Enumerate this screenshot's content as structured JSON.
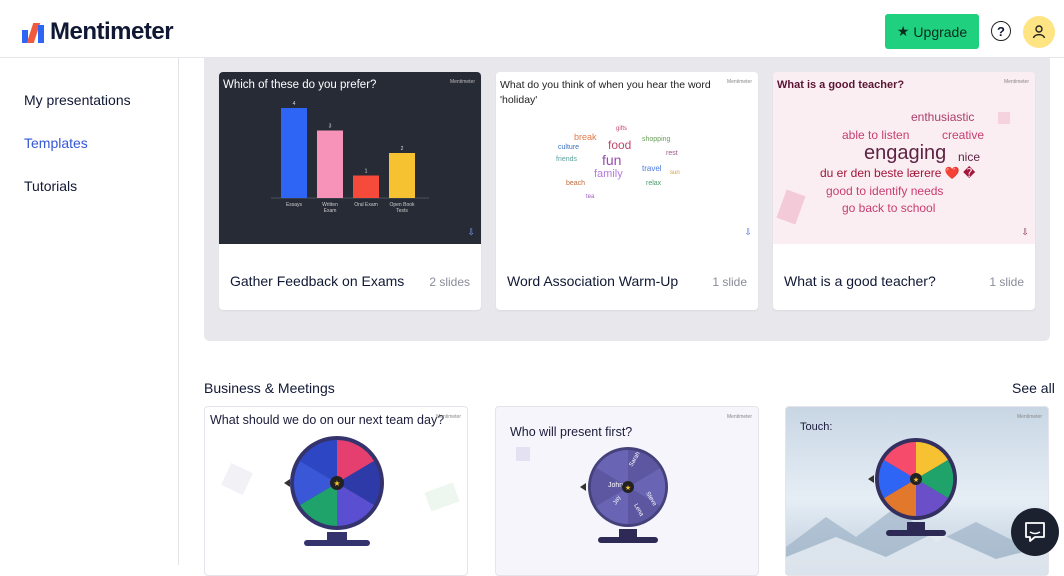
{
  "app": {
    "name": "Mentimeter"
  },
  "header": {
    "upgrade_label": "Upgrade",
    "help_icon": "question-circle-icon",
    "avatar_icon": "user-icon"
  },
  "sidebar": {
    "items": [
      {
        "label": "My presentations",
        "active": false
      },
      {
        "label": "Templates",
        "active": true
      },
      {
        "label": "Tutorials",
        "active": false
      }
    ]
  },
  "templates": [
    {
      "title": "Gather Feedback on Exams",
      "count": "2 slides",
      "question": "Which of these do you prefer?",
      "chart_data": {
        "type": "bar",
        "categories": [
          "Essays",
          "Written Exam",
          "Oral Exam",
          "Open Book Tests"
        ],
        "values": [
          4,
          3,
          1,
          2
        ],
        "colors": [
          "#2f65f5",
          "#f792b8",
          "#f64b3b",
          "#f7c231"
        ]
      }
    },
    {
      "title": "Word Association Warm-Up",
      "count": "1 slide",
      "question": "What do you think of when you hear the word 'holiday'",
      "words": [
        "food",
        "fun",
        "family",
        "travel",
        "break",
        "shopping",
        "friends",
        "rest",
        "beach",
        "culture",
        "relax",
        "tea",
        "gifts",
        "sun"
      ]
    },
    {
      "title": "What is a good teacher?",
      "count": "1 slide",
      "question": "What is a good teacher?",
      "words": [
        {
          "text": "enthusiastic",
          "color": "#ab3d6a"
        },
        {
          "text": "able to listen",
          "color": "#c73d70"
        },
        {
          "text": "creative",
          "color": "#c73d70"
        },
        {
          "text": "engaging",
          "color": "#5d2344"
        },
        {
          "text": "nice",
          "color": "#5d2344"
        },
        {
          "text": "du er den beste lærere ❤️ �",
          "color": "#a3153a"
        },
        {
          "text": "good to identify needs",
          "color": "#c73d70"
        },
        {
          "text": "go back to school",
          "color": "#c73d70"
        }
      ]
    }
  ],
  "business": {
    "title": "Business & Meetings",
    "see_all": "See all",
    "cards": [
      {
        "question": "What should we do on our next team day?"
      },
      {
        "question": "Who will present first?",
        "names": [
          "John",
          "Sarah",
          "Steve",
          "Lena",
          "Jay",
          "Sam"
        ]
      },
      {
        "question": "Touch:"
      }
    ]
  },
  "brand_mini": "Mentimeter",
  "chat_icon": "chat-bubble-icon"
}
